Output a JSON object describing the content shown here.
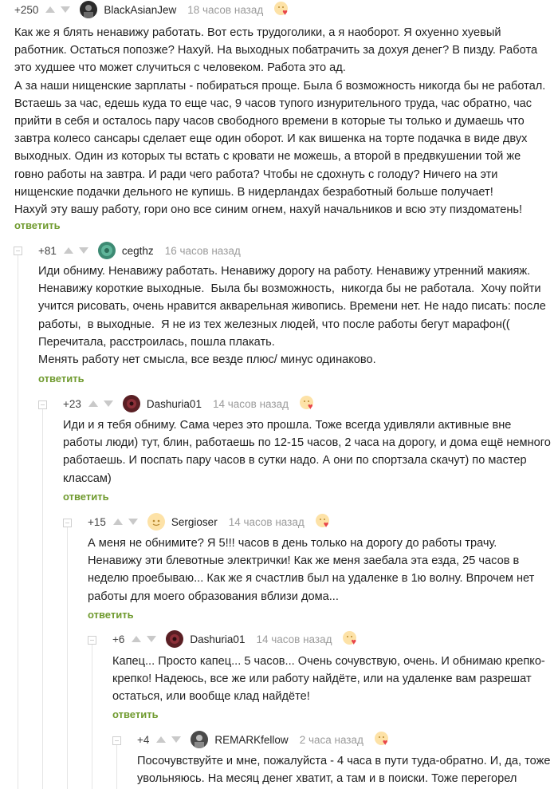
{
  "comments": [
    {
      "rating": "+250",
      "username": "BlackAsianJew",
      "time": "18 часов назад",
      "text": "Как же я блять ненавижу работать. Вот есть трудоголики, а я наоборот. Я охуенно хуевый\nработник. Остаться попозже? Нахуй. На выходных побатрачить за дохуя денег? В пизду. Работа\nэто худшее что может случиться с человеком. Работа это ад.\nА за наши нищенские зарплаты - побираться проще. Была б возможность никогда бы не работал.\nВстаешь за час, едешь куда то еще час, 9 часов тупого изнурительного труда, час обратно, час\nприйти в себя и осталось пару часов свободного времени в которые ты только и думаешь что\nзавтра колесо сансары сделает еще один оборот. И как вишенка на торте подачка в виде двух\nвыходных. Один из которых ты встать с кровати не можешь, а второй в предвкушении той же\nговно работы на завтра. И ради чего работа? Чтобы не сдохнуть с голоду? Ничего на эти\nнищенские подачки дельного не купишь. В нидерландах безработный больше получает!\nНахуй эту вашу работу, гори оно все синим огнем, нахуй начальников и всю эту пиздоматень!",
      "reply": "ответить",
      "avatar_color": "#2b2b2b"
    },
    {
      "rating": "+81",
      "username": "cegthz",
      "time": "16 часов назад",
      "text": "Иди обниму. Ненавижу работать. Ненавижу дорогу на работу. Ненавижу утренний макияж.\nНенавижу короткие выходные.  Была бы возможность,  никогда бы не работала.  Хочу пойти\nучится рисовать, очень нравится акварельная живопись. Времени нет. Не надо писать: после\nработы,  в выходные.  Я не из тех железных людей, что после работы бегут марафон((\nПеречитала, расстроилась, пошла плакать.\nМенять работу нет смысла, все везде плюс/ минус одинаково.",
      "reply": "ответить",
      "avatar_color": "#3d8a73"
    },
    {
      "rating": "+23",
      "username": "Dashuria01",
      "time": "14 часов назад",
      "text": "Иди и я тебя обниму. Сама через это прошла. Тоже всегда удивляли активные вне\nработы люди) тут, блин, работаешь по 12-15 часов, 2 часа на дорогу, и дома ещё немного\nработаешь. И поспать пару часов в сутки надо. А они по спортзала скачут) по мастер\nклассам)",
      "reply": "ответить",
      "avatar_color": "#5a1f24"
    },
    {
      "rating": "+15",
      "username": "Sergioser",
      "time": "14 часов назад",
      "text": "А меня не обнимите? Я 5!!! часов в день только на дорогу до работы трачу.\nНенавижу эти блевотные электрички! Как же меня заебала эта езда, 25 часов в\nнеделю проебываю... Как же я счастлив был на удаленке в 1ю волну. Впрочем нет\nработы для моего образования вблизи дома...",
      "reply": "ответить",
      "avatar_color": "#fde2a7"
    },
    {
      "rating": "+6",
      "username": "Dashuria01",
      "time": "14 часов назад",
      "text": "Капец... Просто капец... 5 часов... Очень сочувствую, очень. И обнимаю крепко-\nкрепко! Надеюсь, все же или работу найдёте, или на удаленке вам разрешат\nостаться, или вообще клад найдёте!",
      "reply": "ответить",
      "avatar_color": "#5a1f24"
    },
    {
      "rating": "+4",
      "username": "REMARKfellow",
      "time": "2 часа назад",
      "text": "Посочувствуйте и мне, пожалуйста - 4 часа в пути туда-обратно. И, да, тоже\nувольняюсь. На месяц денег хватит, а там и в поиски. Тоже перегорел",
      "reply": "",
      "avatar_color": "#4a4a4a"
    }
  ],
  "colors": {
    "reply_link": "#6f9a2e",
    "timestamp": "#9b9b9b",
    "arrow": "#c9c9c9",
    "thread_line": "#e5e5e5"
  }
}
